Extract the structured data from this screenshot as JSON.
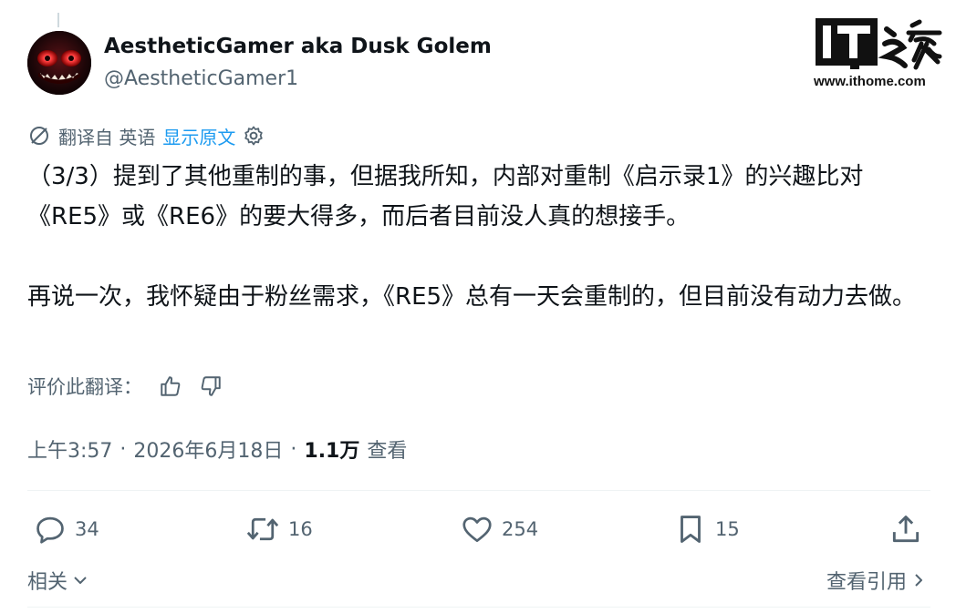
{
  "author": {
    "display_name": "AestheticGamer aka Dusk Golem",
    "handle": "@AestheticGamer1"
  },
  "watermark": {
    "logo_text": "IT之家",
    "url": "www.ithome.com"
  },
  "translation": {
    "translated_from": "翻译自 英语",
    "show_original": "显示原文"
  },
  "tweet": {
    "paragraph_1": "（3/3）提到了其他重制的事，但据我所知，内部对重制《启示录1》的兴趣比对《RE5》或《RE6》的要大得多，而后者目前没人真的想接手。",
    "paragraph_2": "再说一次，我怀疑由于粉丝需求，《RE5》总有一天会重制的，但目前没有动力去做。"
  },
  "rate_translation": {
    "label": "评价此翻译："
  },
  "meta": {
    "time": "上午3:57",
    "separator_1": "·",
    "date": "2026年6月18日",
    "separator_2": "·",
    "views_count": "1.1万",
    "views_label": "查看"
  },
  "actions": {
    "replies": "34",
    "retweets": "16",
    "likes": "254",
    "bookmarks": "15"
  },
  "footer": {
    "related": "相关",
    "view_quotes": "查看引用"
  },
  "colors": {
    "text_primary": "#0f1419",
    "text_secondary": "#536471",
    "link_blue": "#1d9bf0",
    "divider": "#eff3f4"
  },
  "icons": {
    "translate": "translate-icon",
    "settings": "gear-icon",
    "thumbs_up": "thumbs-up-icon",
    "thumbs_down": "thumbs-down-icon",
    "reply": "reply-icon",
    "retweet": "retweet-icon",
    "like": "heart-icon",
    "bookmark": "bookmark-icon",
    "share": "share-icon",
    "chevron_down": "chevron-down-icon",
    "chevron_right": "chevron-right-icon"
  }
}
